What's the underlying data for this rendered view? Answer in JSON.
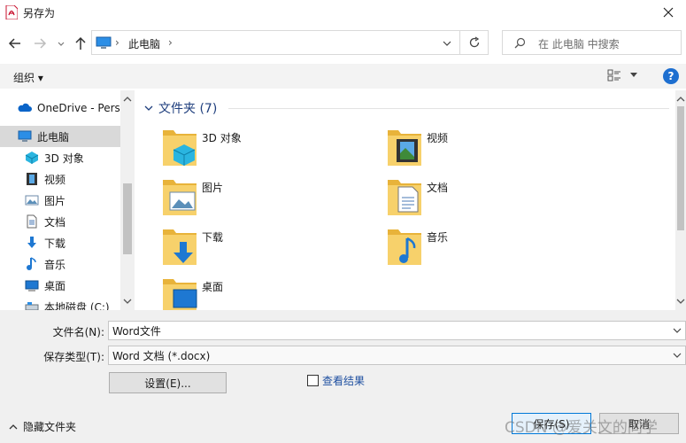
{
  "window": {
    "title": "另存为"
  },
  "address": {
    "location": "此电脑",
    "separator": "›"
  },
  "search": {
    "placeholder": "在 此电脑 中搜索"
  },
  "toolbar": {
    "organize_label": "组织 ▾",
    "help_label": "?"
  },
  "nav": {
    "items": [
      {
        "label": "OneDrive - Perso",
        "icon": "cloud-icon"
      },
      {
        "label": "此电脑",
        "icon": "computer-icon",
        "selected": true
      },
      {
        "label": "3D 对象",
        "icon": "cube-icon"
      },
      {
        "label": "视频",
        "icon": "film-icon"
      },
      {
        "label": "图片",
        "icon": "picture-icon"
      },
      {
        "label": "文档",
        "icon": "document-icon"
      },
      {
        "label": "下载",
        "icon": "download-arrow-icon"
      },
      {
        "label": "音乐",
        "icon": "music-note-icon"
      },
      {
        "label": "桌面",
        "icon": "desktop-icon"
      },
      {
        "label": "本地磁盘 (C:)",
        "icon": "drive-icon"
      }
    ]
  },
  "main": {
    "group_header": "文件夹 (7)",
    "folders": [
      {
        "name": "3D 对象",
        "icon": "cube-icon"
      },
      {
        "name": "视频",
        "icon": "film-icon"
      },
      {
        "name": "图片",
        "icon": "picture-icon"
      },
      {
        "name": "文档",
        "icon": "document-icon"
      },
      {
        "name": "下载",
        "icon": "download-arrow-icon"
      },
      {
        "name": "音乐",
        "icon": "music-note-icon"
      },
      {
        "name": "桌面",
        "icon": "desktop-icon"
      }
    ]
  },
  "form": {
    "filename_label": "文件名(N):",
    "filename_value": "Word文件",
    "filetype_label": "保存类型(T):",
    "filetype_value": "Word 文档 (*.docx)",
    "settings_label": "设置(E)...",
    "view_results_label": "查看结果",
    "hide_folders_label": "隐藏文件夹",
    "save_label": "保存(S)",
    "cancel_label": "取消"
  },
  "watermark": "CSDN @爱关文的同学",
  "colors": {
    "accent": "#0078d7",
    "header": "#1e3e7d",
    "folder": "#f4c44e",
    "help": "#1e6fd0"
  }
}
